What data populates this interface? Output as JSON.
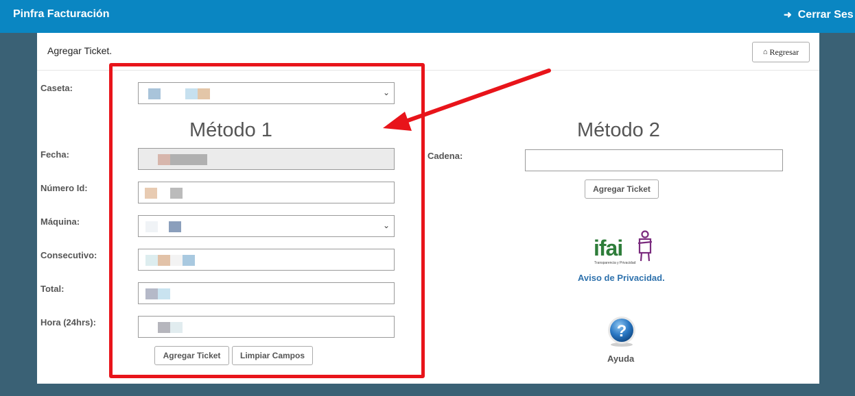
{
  "header": {
    "brand": "Pinfra Facturación",
    "logout_label": "Cerrar Ses"
  },
  "panel": {
    "title": "Agregar Ticket.",
    "back_label": "Regresar"
  },
  "method1": {
    "title": "Método 1",
    "caseta_label": "Caseta:",
    "fecha_label": "Fecha:",
    "numero_id_label": "Número Id:",
    "maquina_label": "Máquina:",
    "consecutivo_label": "Consecutivo:",
    "total_label": "Total:",
    "hora_label": "Hora (24hrs):",
    "add_button": "Agregar Ticket",
    "clear_button": "Limpiar Campos"
  },
  "method2": {
    "title": "Método 2",
    "cadena_label": "Cadena:",
    "add_button": "Agregar Ticket"
  },
  "ifai": {
    "logo_text": "ifai",
    "logo_subtext": "Transparencia y Privacidad",
    "privacy_link": "Aviso de Privacidad."
  },
  "help": {
    "label": "Ayuda",
    "icon": "question-icon"
  },
  "colors": {
    "topbar": "#0a86c2",
    "background": "#3a6175",
    "highlight": "#e8141a",
    "link": "#2f72ad"
  }
}
